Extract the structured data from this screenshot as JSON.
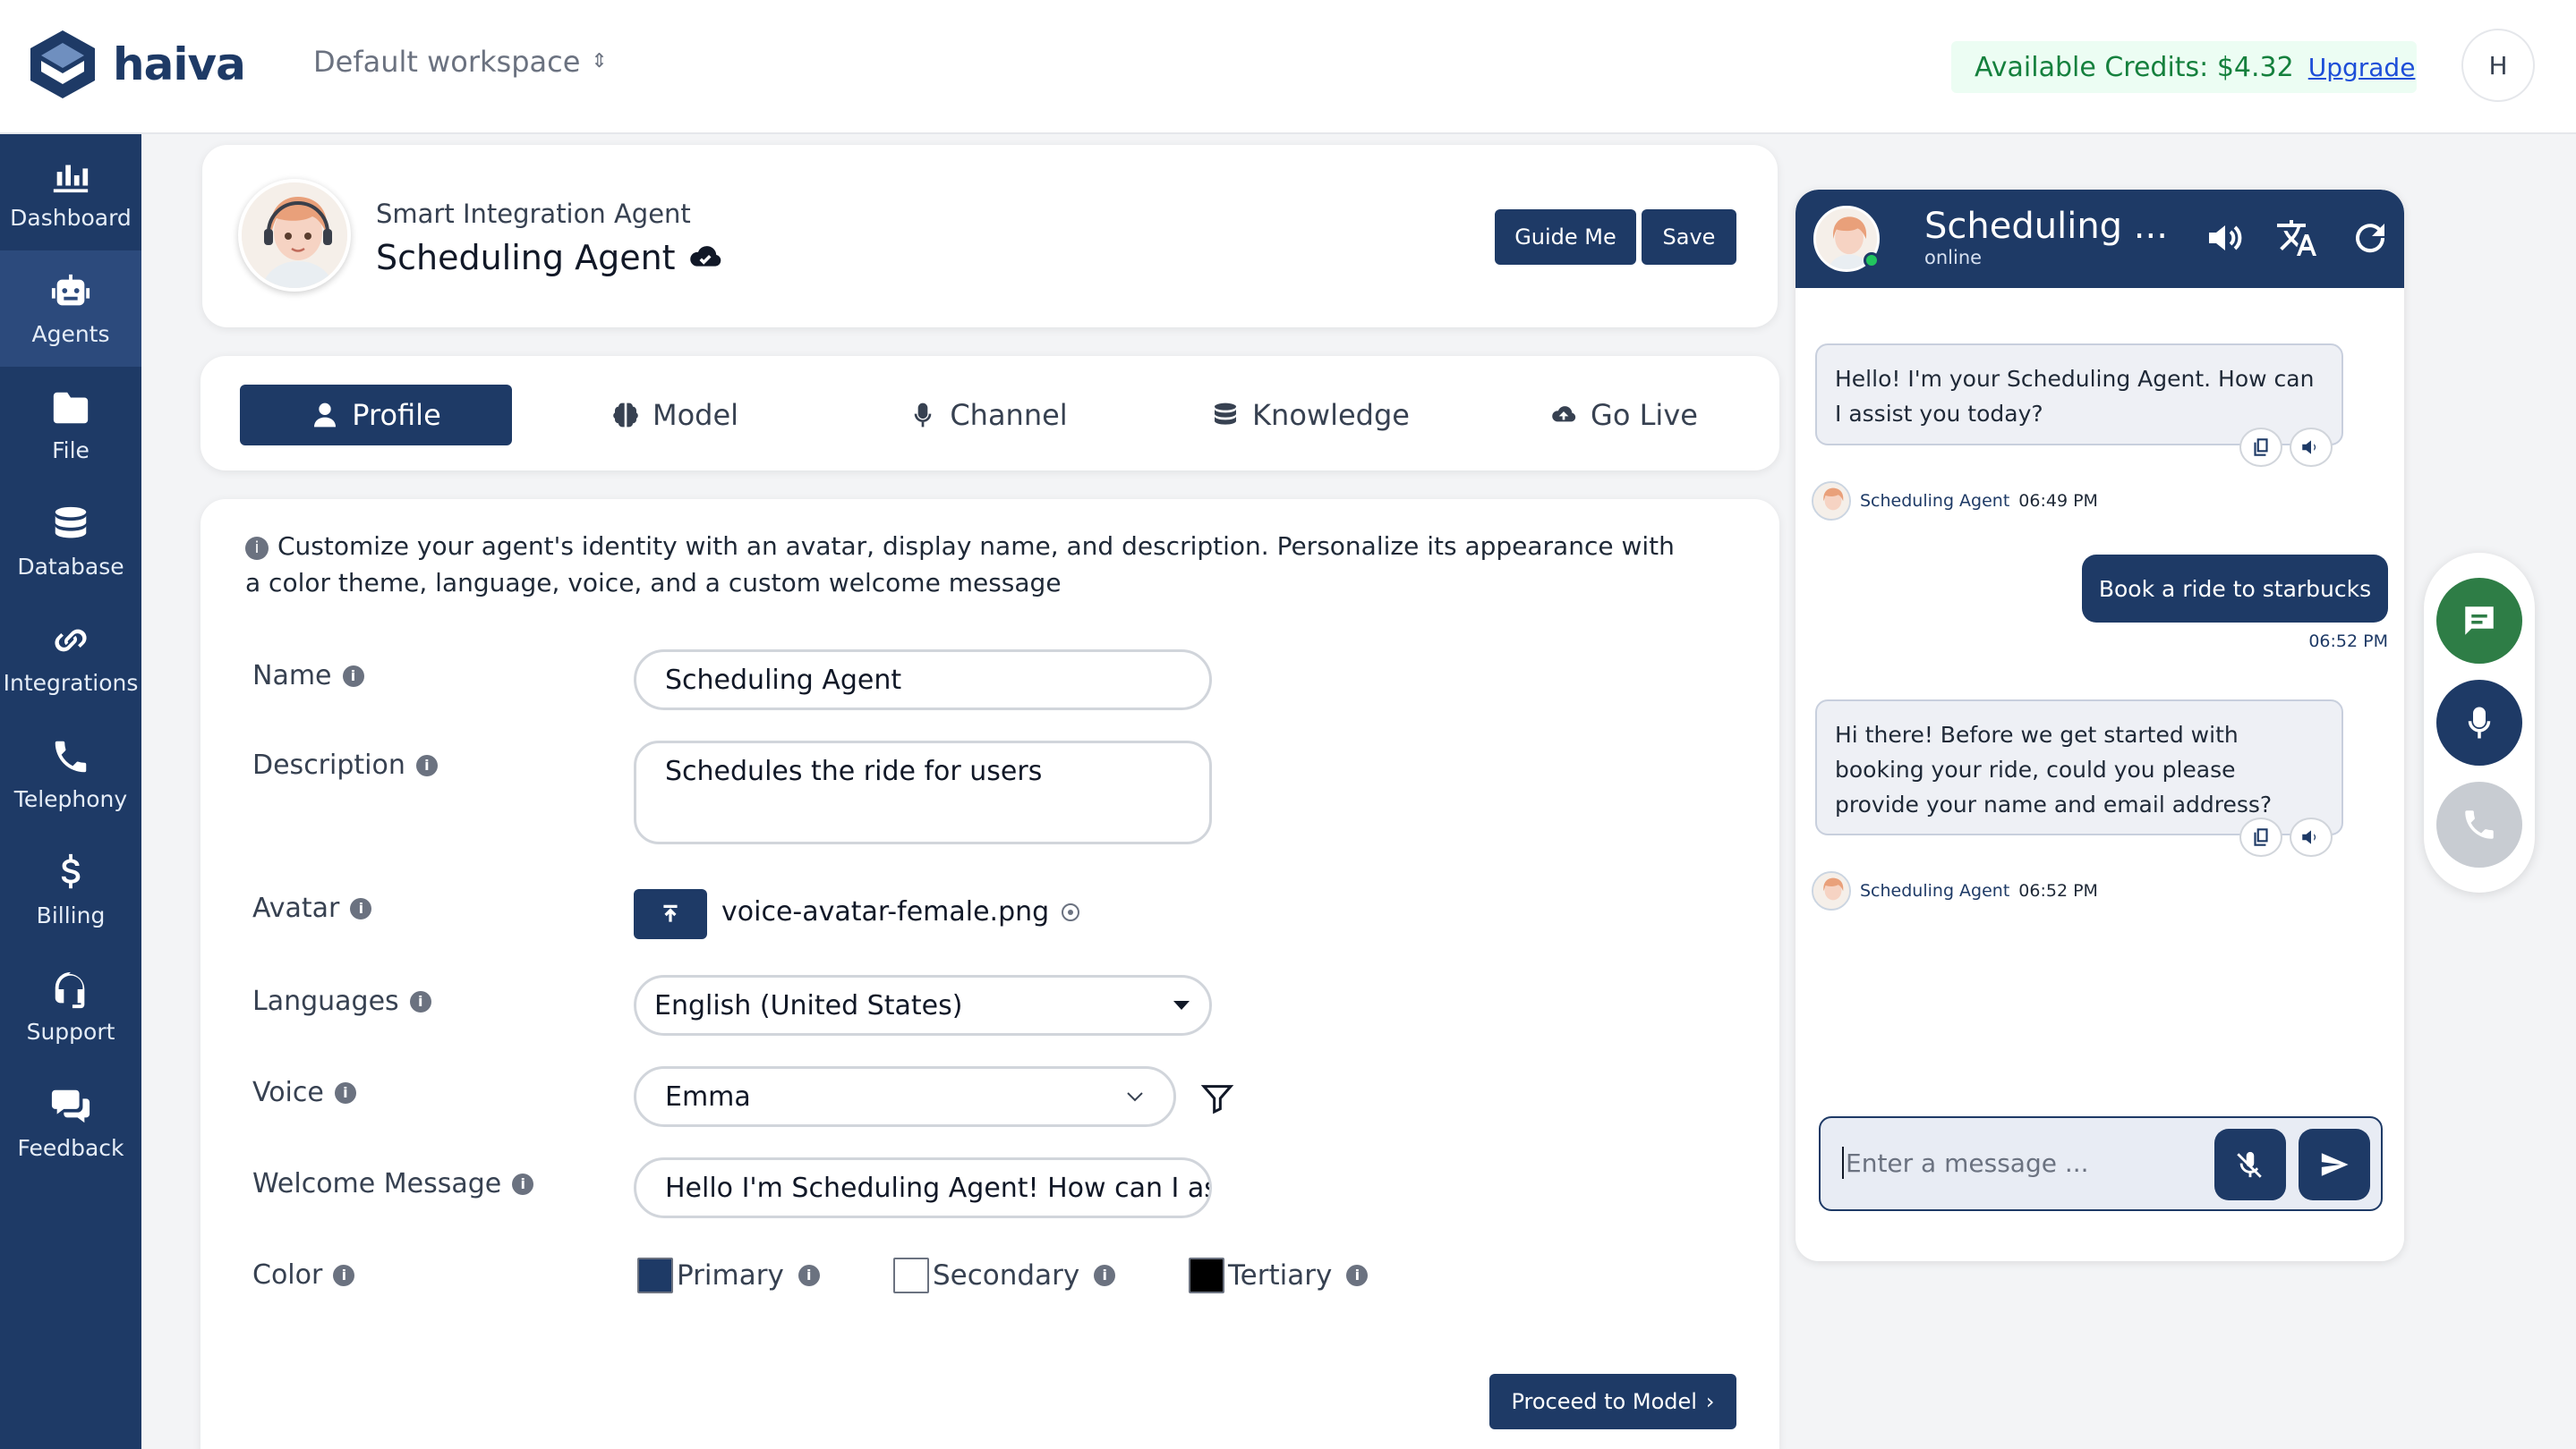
{
  "brand": {
    "name": "haiva"
  },
  "header": {
    "workspace": "Default workspace",
    "credits_label": "Available Credits: $4.32",
    "upgrade": "Upgrade",
    "user_initial": "H"
  },
  "sidebar": {
    "items": [
      {
        "label": "Dashboard",
        "icon": "chart-icon"
      },
      {
        "label": "Agents",
        "icon": "robot-icon",
        "active": true
      },
      {
        "label": "File",
        "icon": "folder-icon"
      },
      {
        "label": "Database",
        "icon": "database-icon"
      },
      {
        "label": "Integrations",
        "icon": "link-icon"
      },
      {
        "label": "Telephony",
        "icon": "phone-icon"
      },
      {
        "label": "Billing",
        "icon": "dollar-icon"
      },
      {
        "label": "Support",
        "icon": "headset-icon"
      },
      {
        "label": "Feedback",
        "icon": "comments-icon"
      }
    ]
  },
  "agent": {
    "type": "Smart Integration Agent",
    "name": "Scheduling Agent",
    "guide_me": "Guide Me",
    "save": "Save"
  },
  "tabs": [
    {
      "label": "Profile",
      "icon": "user-icon",
      "active": true
    },
    {
      "label": "Model",
      "icon": "brain-icon"
    },
    {
      "label": "Channel",
      "icon": "microphone-icon"
    },
    {
      "label": "Knowledge",
      "icon": "database-icon"
    },
    {
      "label": "Go Live",
      "icon": "cloud-upload-icon"
    }
  ],
  "form": {
    "info": "Customize your agent's identity with an avatar, display name, and description. Personalize its appearance with a color theme, language, voice, and a custom welcome message",
    "name_label": "Name",
    "name_value": "Scheduling Agent",
    "description_label": "Description",
    "description_value": "Schedules the ride for users",
    "avatar_label": "Avatar",
    "avatar_file": "voice-avatar-female.png",
    "languages_label": "Languages",
    "language_value": "English (United States)",
    "voice_label": "Voice",
    "voice_value": "Emma",
    "welcome_label": "Welcome Message",
    "welcome_value": "Hello I'm Scheduling Agent! How can I assist you today?",
    "color_label": "Color",
    "colors": [
      {
        "label": "Primary",
        "hex": "#1e3a66"
      },
      {
        "label": "Secondary",
        "hex": "#ffffff"
      },
      {
        "label": "Tertiary",
        "hex": "#000000"
      }
    ],
    "proceed": "Proceed to Model"
  },
  "chat": {
    "title": "Scheduling ...",
    "status": "online",
    "messages": [
      {
        "from": "bot",
        "text": "Hello! I'm your Scheduling Agent. How can I assist you today?",
        "sender": "Scheduling Agent",
        "time": "06:49 PM"
      },
      {
        "from": "user",
        "text": "Book a ride to starbucks",
        "time": "06:52 PM"
      },
      {
        "from": "bot",
        "text": "Hi there! Before we get started with booking your ride, could you please provide your name and email address?",
        "sender": "Scheduling Agent",
        "time": "06:52 PM"
      }
    ],
    "input_placeholder": "Enter a message ..."
  },
  "colors": {
    "navy": "#1e3a66",
    "fab_chat": "#2e7d46",
    "fab_voice": "#1e3a66",
    "fab_phone": "#c8ccd2",
    "credits_text": "#15803d"
  }
}
